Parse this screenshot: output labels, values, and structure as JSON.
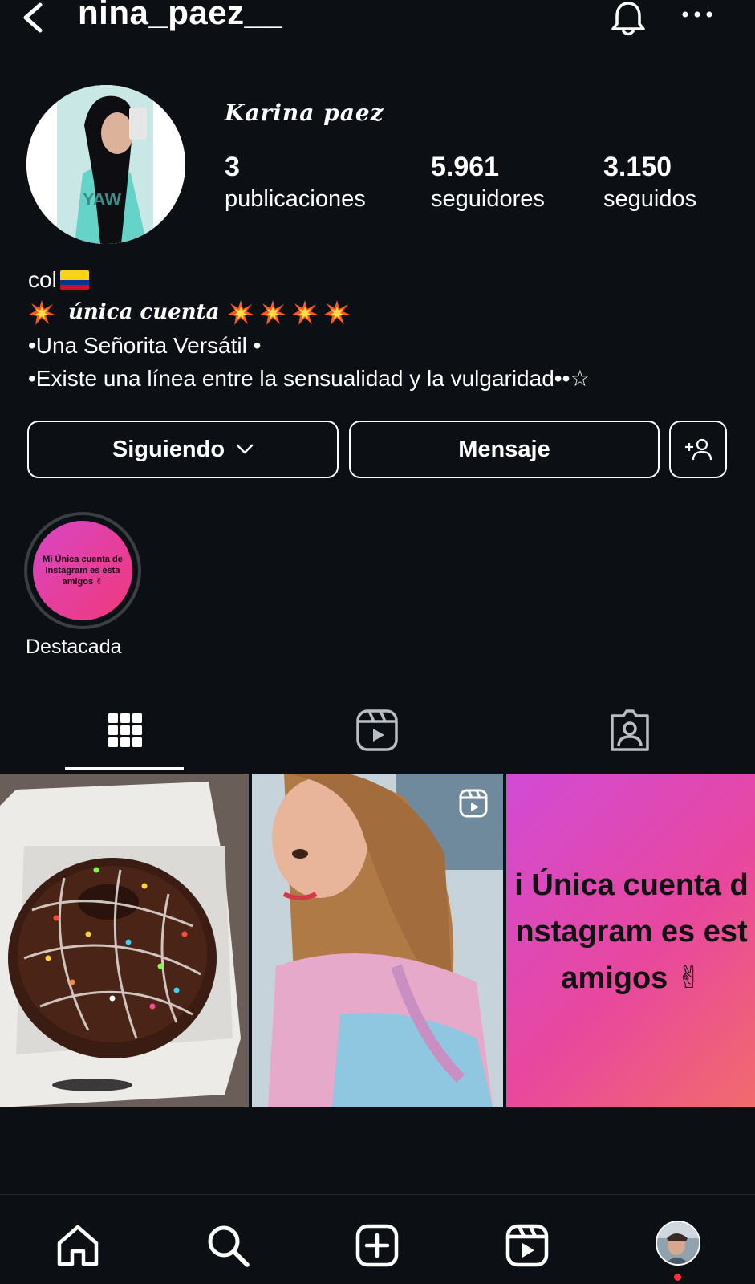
{
  "header": {
    "username": "nina_paez__",
    "icons": {
      "back": "chevron-left-icon",
      "notifications": "bell-icon",
      "more": "more-horizontal-icon"
    }
  },
  "profile": {
    "display_name": "Karina paez",
    "stats": {
      "posts_count": "3",
      "posts_label": "publicaciones",
      "followers_count": "5.961",
      "followers_label": "seguidores",
      "following_count": "3.150",
      "following_label": "seguidos"
    },
    "bio": {
      "line1": "col",
      "line2": "única cuenta",
      "line3": "•Una Señorita Versátil •",
      "line4": "•Existe una línea entre la sensualidad y la vulgaridad••☆"
    }
  },
  "actions": {
    "following_label": "Siguiendo",
    "message_label": "Mensaje"
  },
  "highlights": [
    {
      "label": "Destacada",
      "cover_text": "Mi Única cuenta de Instagram es esta amigos ✌"
    }
  ],
  "tabs": {
    "active": "grid",
    "items": [
      "grid-icon",
      "reels-icon",
      "tagged-icon"
    ]
  },
  "posts": [
    {
      "kind": "photo",
      "subject": "chocolate donut"
    },
    {
      "kind": "reel",
      "subject": "woman selfie"
    },
    {
      "kind": "text",
      "text_lines": [
        "i Única cuenta d",
        "nstagram es est",
        "amigos ✌"
      ]
    }
  ],
  "bottom_nav": {
    "items": [
      "home-icon",
      "search-icon",
      "create-icon",
      "reels-icon",
      "profile-avatar"
    ],
    "notification_dot_color": "#ff3040"
  },
  "colors": {
    "background": "#0c1014",
    "text": "#ffffff",
    "accent_pink": "#e8479e"
  }
}
